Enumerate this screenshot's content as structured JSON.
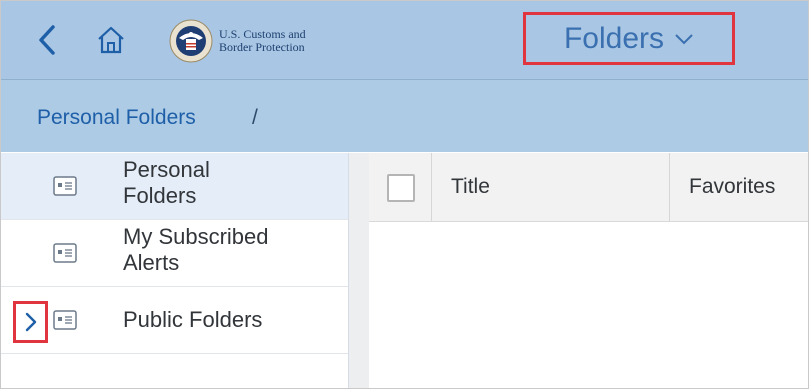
{
  "header": {
    "logo_line1": "U.S. Customs and",
    "logo_line2": "Border Protection",
    "menu_title": "Folders"
  },
  "breadcrumb": {
    "item": "Personal Folders",
    "separator": "/"
  },
  "sidebar": {
    "items": [
      {
        "line1": "Personal",
        "line2": "Folders",
        "selected": true
      },
      {
        "line1": "My Subscribed",
        "line2": "Alerts",
        "selected": false
      },
      {
        "line1": "Public Folders",
        "line2": "",
        "selected": false
      }
    ]
  },
  "table": {
    "columns": [
      "Title",
      "Favorites"
    ]
  },
  "icons": {
    "back": "chevron-left-icon",
    "home": "home-icon",
    "menu_caret": "chevron-down-icon",
    "folder": "folder-card-icon",
    "expand": "chevron-right-icon"
  },
  "colors": {
    "header_bg": "#a9c7e4",
    "breadcrumb_bg": "#aecbe6",
    "link_blue": "#1e5fa8",
    "highlight_red": "#e0343e"
  }
}
